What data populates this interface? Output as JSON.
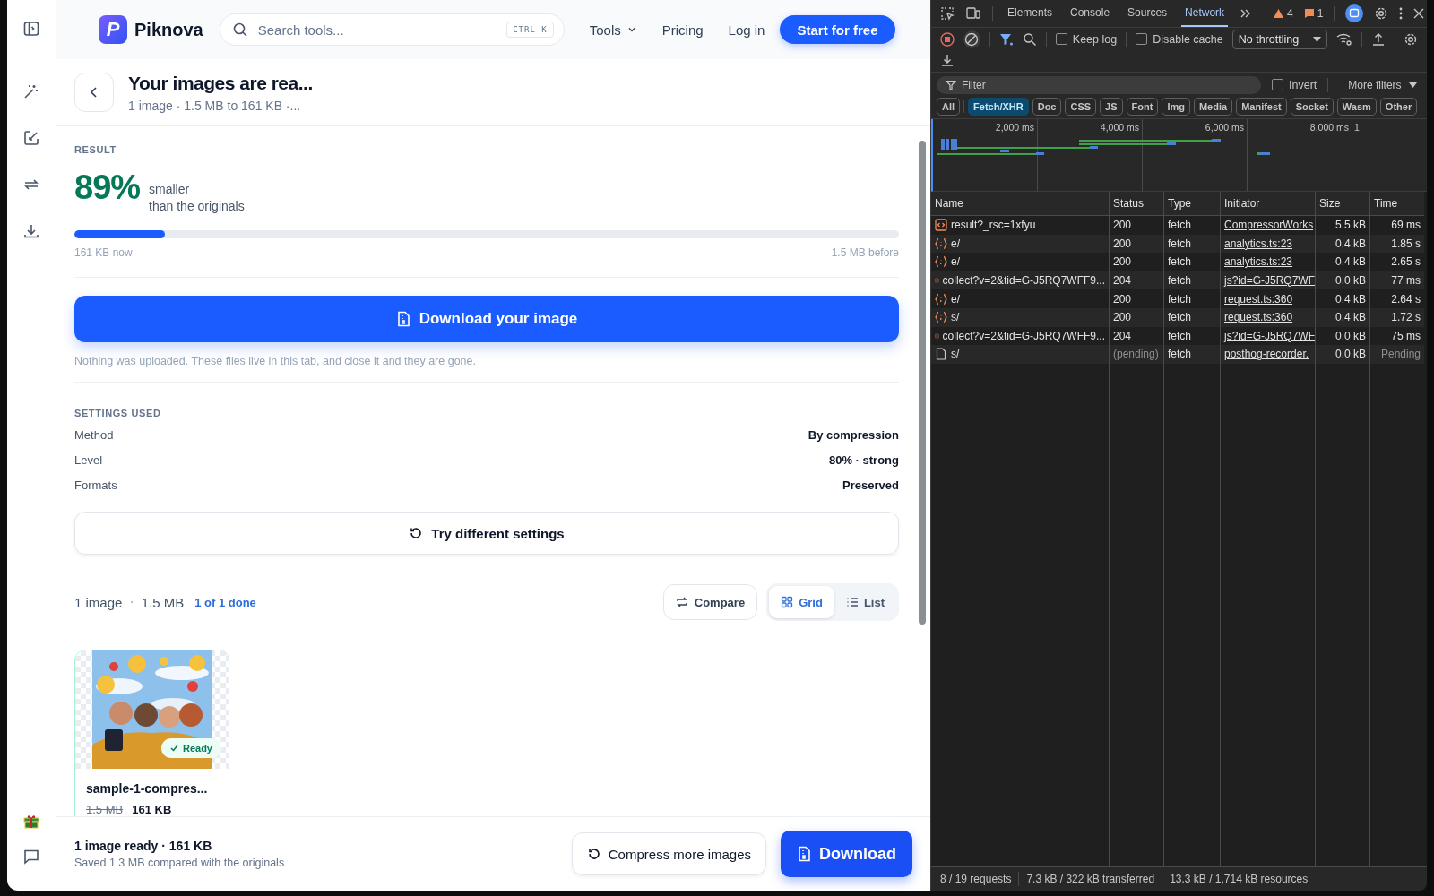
{
  "header": {
    "logo_letter": "P",
    "brand": "Piknova",
    "search": {
      "placeholder": "Search tools...",
      "shortcut": "CTRL K"
    },
    "nav": [
      {
        "label": "Tools",
        "dropdown": true
      },
      {
        "label": "Pricing",
        "dropdown": false
      },
      {
        "label": "Log in",
        "dropdown": false
      }
    ],
    "cta": "Start for free"
  },
  "page_header": {
    "title": "Your images are rea...",
    "subtitle": "1 image · 1.5 MB to 161 KB ·..."
  },
  "result": {
    "label": "RESULT",
    "percent": "89%",
    "caption_1": "smaller",
    "caption_2": "than the originals",
    "level": 0.11,
    "now": "161 KB now",
    "before": "1.5 MB before"
  },
  "download_button": "Download your image",
  "privacy_note": "Nothing was uploaded. These files live in this tab, and close it and they are gone.",
  "settings": {
    "label": "SETTINGS USED",
    "rows": [
      {
        "name": "Method",
        "value": "By compression"
      },
      {
        "name": "Level",
        "value": "80% · strong"
      },
      {
        "name": "Formats",
        "value": "Preserved"
      }
    ]
  },
  "retry_button": "Try different settings",
  "files_bar": {
    "count": "1 image",
    "separator": "·",
    "size": "1.5 MB",
    "progress": "1 of 1 done",
    "compare": "Compare",
    "views": [
      {
        "label": "Grid",
        "selected": true
      },
      {
        "label": "List",
        "selected": false
      }
    ]
  },
  "files": [
    {
      "name": "sample-1-compres...",
      "original_size": "1.5 MB",
      "new_size": "161 KB",
      "badge": "Ready"
    }
  ],
  "footer": {
    "summary": "1 image ready · 161 KB",
    "saved": "Saved 1.3 MB compared with the originals",
    "secondary": "Compress more images",
    "primary": "Download"
  },
  "devtools": {
    "tabs": [
      {
        "label": "Elements",
        "selected": false
      },
      {
        "label": "Console",
        "selected": false
      },
      {
        "label": "Sources",
        "selected": false
      },
      {
        "label": "Network",
        "selected": true
      }
    ],
    "warnings": "4",
    "errors": "1",
    "keep_log": {
      "label": "Keep log",
      "checked": false
    },
    "disable_cache": {
      "label": "Disable cache",
      "checked": false
    },
    "throttling": "No throttling",
    "filter": {
      "placeholder": "Filter",
      "invert": {
        "label": "Invert",
        "checked": false
      },
      "more_filters": "More filters"
    },
    "types": [
      {
        "label": "All",
        "selected": false
      },
      {
        "label": "Fetch/XHR",
        "selected": true
      },
      {
        "label": "Doc",
        "selected": false
      },
      {
        "label": "CSS",
        "selected": false
      },
      {
        "label": "JS",
        "selected": false
      },
      {
        "label": "Font",
        "selected": false
      },
      {
        "label": "Img",
        "selected": false
      },
      {
        "label": "Media",
        "selected": false
      },
      {
        "label": "Manifest",
        "selected": false
      },
      {
        "label": "Socket",
        "selected": false
      },
      {
        "label": "Wasm",
        "selected": false
      },
      {
        "label": "Other",
        "selected": false
      }
    ],
    "timeline_ticks": [
      "2,000 ms",
      "4,000 ms",
      "6,000 ms",
      "8,000 ms",
      "1"
    ],
    "columns": [
      "Name",
      "Status",
      "Type",
      "Initiator",
      "Size",
      "Time"
    ],
    "rows": [
      {
        "kind": "fetch",
        "name": "result?_rsc=1xfyu",
        "status": "200",
        "type": "fetch",
        "initiator": "CompressorWorks",
        "size": "5.5 kB",
        "time": "69 ms",
        "pending": false
      },
      {
        "kind": "json",
        "name": "e/",
        "status": "200",
        "type": "fetch",
        "initiator": "analytics.ts:23",
        "size": "0.4 kB",
        "time": "1.85 s",
        "pending": false
      },
      {
        "kind": "json",
        "name": "e/",
        "status": "200",
        "type": "fetch",
        "initiator": "analytics.ts:23",
        "size": "0.4 kB",
        "time": "2.65 s",
        "pending": false
      },
      {
        "kind": "fetch",
        "name": "collect?v=2&tid=G-J5RQ7WFF9...",
        "status": "204",
        "type": "fetch",
        "initiator": "js?id=G-J5RQ7WF",
        "size": "0.0 kB",
        "time": "77 ms",
        "pending": false
      },
      {
        "kind": "json",
        "name": "e/",
        "status": "200",
        "type": "fetch",
        "initiator": "request.ts:360",
        "size": "0.4 kB",
        "time": "2.64 s",
        "pending": false
      },
      {
        "kind": "json",
        "name": "s/",
        "status": "200",
        "type": "fetch",
        "initiator": "request.ts:360",
        "size": "0.4 kB",
        "time": "1.72 s",
        "pending": false
      },
      {
        "kind": "fetch",
        "name": "collect?v=2&tid=G-J5RQ7WFF9...",
        "status": "204",
        "type": "fetch",
        "initiator": "js?id=G-J5RQ7WF",
        "size": "0.0 kB",
        "time": "75 ms",
        "pending": false
      },
      {
        "kind": "other",
        "name": "s/",
        "status": "(pending)",
        "type": "fetch",
        "initiator": "posthog-recorder.",
        "size": "0.0 kB",
        "time": "Pending",
        "pending": true
      }
    ],
    "status_bar": [
      "8 / 19 requests",
      "7.3 kB / 322 kB transferred",
      "13.3 kB / 1,714 kB resources"
    ]
  }
}
